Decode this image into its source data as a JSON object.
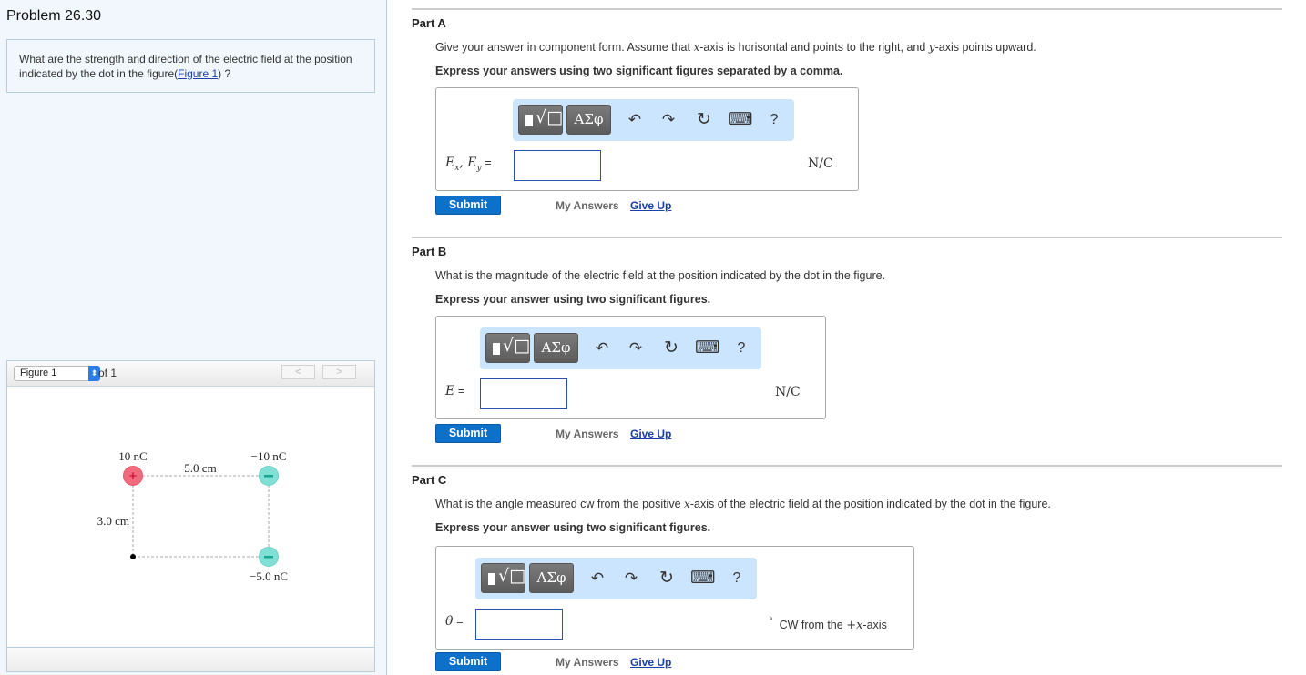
{
  "problem": {
    "title": "Problem 26.30",
    "question_prefix": "What are the strength and direction of the electric field at the position indicated by the dot in the figure(",
    "figure_link": "Figure 1",
    "question_suffix": ") ?"
  },
  "figure": {
    "select_value": "Figure 1",
    "of_label": "of 1",
    "prev_label": "<",
    "next_label": ">",
    "charges": [
      {
        "label": "10 nC",
        "sign": "+",
        "color": "#f26a7e",
        "position": "top-left"
      },
      {
        "label": "−10 nC",
        "sign": "−",
        "color": "#7fe0d6",
        "position": "top-right"
      },
      {
        "label": "−5.0 nC",
        "sign": "−",
        "color": "#7fe0d6",
        "position": "bottom-right"
      }
    ],
    "dot_position": "bottom-left",
    "horizontal_distance": "5.0 cm",
    "vertical_distance": "3.0 cm"
  },
  "toolbar": {
    "template_icon": "radical-template-icon",
    "greek_label": "ΑΣφ",
    "undo_icon": "↶",
    "redo_icon": "↷",
    "reset_icon": "↻",
    "keyboard_icon": "⌨",
    "help_label": "?"
  },
  "parts": [
    {
      "title": "Part A",
      "question_a": "Give your answer in component form. Assume that ",
      "var1": "x",
      "question_b": "-axis is horisontal and points to the right, and ",
      "var2": "y",
      "question_c": "-axis points upward.",
      "hint": "Express your answers using two significant figures separated by a comma.",
      "answer_label_html": "E_x, E_y =",
      "answer_value": "",
      "unit": "N/C",
      "submit": "Submit",
      "my_answers": "My Answers",
      "give_up": "Give Up"
    },
    {
      "title": "Part B",
      "question": "What is the magnitude of the electric field at the position indicated by the dot in the figure.",
      "hint": "Express your answer using two significant figures.",
      "answer_label": "E",
      "equals": "=",
      "answer_value": "",
      "unit": "N/C",
      "submit": "Submit",
      "my_answers": "My Answers",
      "give_up": "Give Up"
    },
    {
      "title": "Part C",
      "question_a": "What is the angle measured cw from the positive ",
      "var1": "x",
      "question_b": "-axis of the electric field at the position indicated by the dot in the figure.",
      "hint": "Express your answer using two significant figures.",
      "answer_label": "θ",
      "equals": "=",
      "answer_value": "",
      "unit_degree": "°",
      "unit_text_a": "CW from the ",
      "unit_plus_x": "+x",
      "unit_text_b": "-axis",
      "submit": "Submit",
      "my_answers": "My Answers",
      "give_up": "Give Up"
    }
  ]
}
